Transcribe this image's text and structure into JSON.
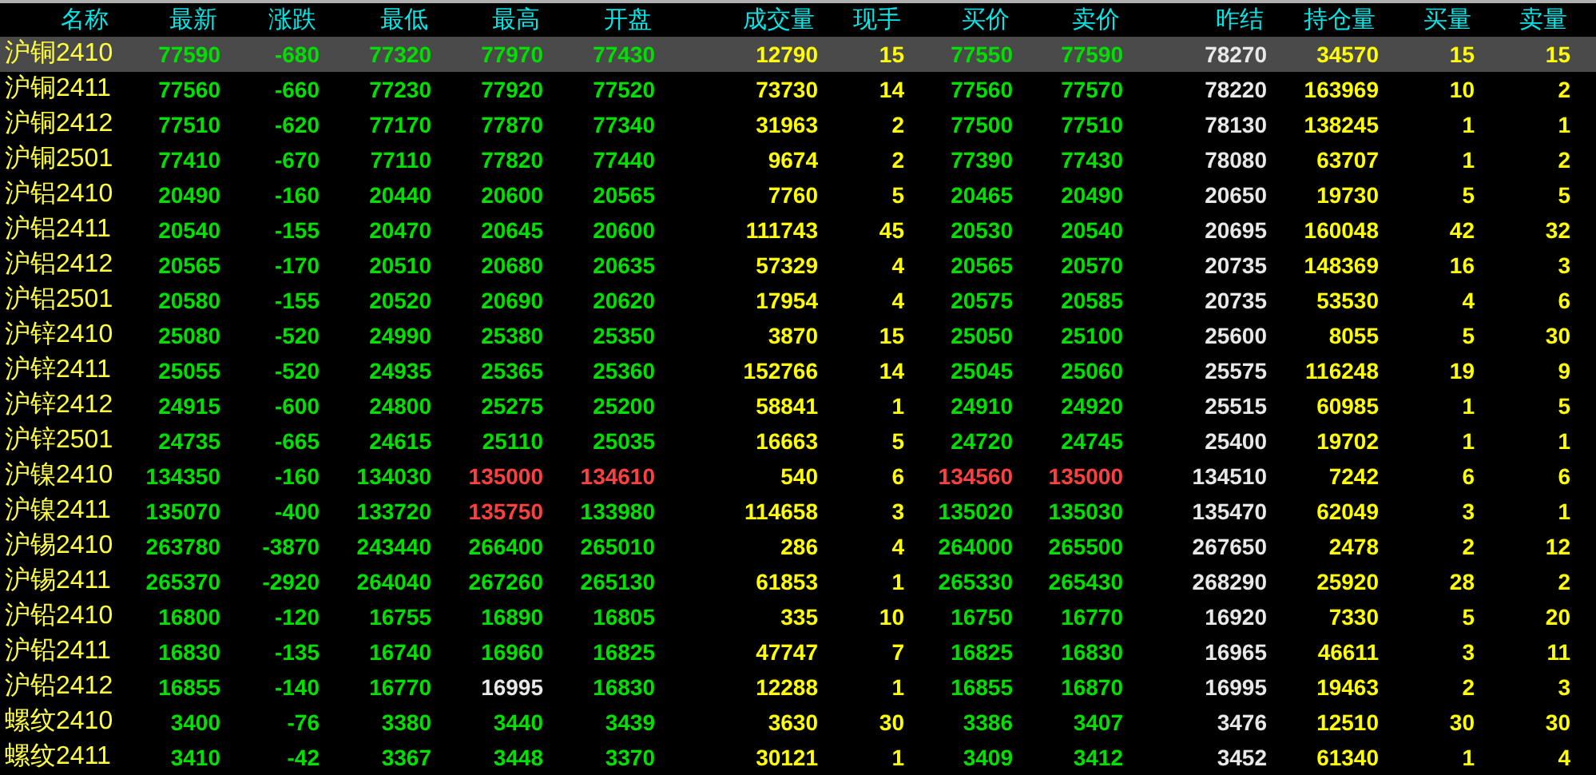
{
  "columns": [
    {
      "label": "名称",
      "kind": "name"
    },
    {
      "label": "最新",
      "kind": "price"
    },
    {
      "label": "涨跌",
      "kind": "price"
    },
    {
      "label": "最低",
      "kind": "price"
    },
    {
      "label": "最高",
      "kind": "price"
    },
    {
      "label": "开盘",
      "kind": "price"
    },
    {
      "label": "成交量",
      "kind": "volume"
    },
    {
      "label": "现手",
      "kind": "volume"
    },
    {
      "label": "买价",
      "kind": "price"
    },
    {
      "label": "卖价",
      "kind": "price"
    },
    {
      "label": "昨结",
      "kind": "settle"
    },
    {
      "label": "持仓量",
      "kind": "volume"
    },
    {
      "label": "买量",
      "kind": "volume"
    },
    {
      "label": "卖量",
      "kind": "volume"
    }
  ],
  "rows": [
    {
      "selected": true,
      "cells": [
        {
          "text": "沪铜2410"
        },
        {
          "text": "77590",
          "color": "#00e000"
        },
        {
          "text": "-680",
          "color": "#00e000"
        },
        {
          "text": "77320",
          "color": "#00e000"
        },
        {
          "text": "77970",
          "color": "#00e000"
        },
        {
          "text": "77430",
          "color": "#00e000"
        },
        {
          "text": "12790"
        },
        {
          "text": "15"
        },
        {
          "text": "77550",
          "color": "#00e000"
        },
        {
          "text": "77590",
          "color": "#00e000"
        },
        {
          "text": "78270"
        },
        {
          "text": "34570"
        },
        {
          "text": "15"
        },
        {
          "text": "15"
        }
      ]
    },
    {
      "selected": false,
      "cells": [
        {
          "text": "沪铜2411"
        },
        {
          "text": "77560",
          "color": "#00e000"
        },
        {
          "text": "-660",
          "color": "#00e000"
        },
        {
          "text": "77230",
          "color": "#00e000"
        },
        {
          "text": "77920",
          "color": "#00e000"
        },
        {
          "text": "77520",
          "color": "#00e000"
        },
        {
          "text": "73730"
        },
        {
          "text": "14"
        },
        {
          "text": "77560",
          "color": "#00e000"
        },
        {
          "text": "77570",
          "color": "#00e000"
        },
        {
          "text": "78220"
        },
        {
          "text": "163969"
        },
        {
          "text": "10"
        },
        {
          "text": "2"
        }
      ]
    },
    {
      "selected": false,
      "cells": [
        {
          "text": "沪铜2412"
        },
        {
          "text": "77510",
          "color": "#00e000"
        },
        {
          "text": "-620",
          "color": "#00e000"
        },
        {
          "text": "77170",
          "color": "#00e000"
        },
        {
          "text": "77870",
          "color": "#00e000"
        },
        {
          "text": "77340",
          "color": "#00e000"
        },
        {
          "text": "31963"
        },
        {
          "text": "2"
        },
        {
          "text": "77500",
          "color": "#00e000"
        },
        {
          "text": "77510",
          "color": "#00e000"
        },
        {
          "text": "78130"
        },
        {
          "text": "138245"
        },
        {
          "text": "1"
        },
        {
          "text": "1"
        }
      ]
    },
    {
      "selected": false,
      "cells": [
        {
          "text": "沪铜2501"
        },
        {
          "text": "77410",
          "color": "#00e000"
        },
        {
          "text": "-670",
          "color": "#00e000"
        },
        {
          "text": "77110",
          "color": "#00e000"
        },
        {
          "text": "77820",
          "color": "#00e000"
        },
        {
          "text": "77440",
          "color": "#00e000"
        },
        {
          "text": "9674"
        },
        {
          "text": "2"
        },
        {
          "text": "77390",
          "color": "#00e000"
        },
        {
          "text": "77430",
          "color": "#00e000"
        },
        {
          "text": "78080"
        },
        {
          "text": "63707"
        },
        {
          "text": "1"
        },
        {
          "text": "2"
        }
      ]
    },
    {
      "selected": false,
      "cells": [
        {
          "text": "沪铝2410"
        },
        {
          "text": "20490",
          "color": "#00e000"
        },
        {
          "text": "-160",
          "color": "#00e000"
        },
        {
          "text": "20440",
          "color": "#00e000"
        },
        {
          "text": "20600",
          "color": "#00e000"
        },
        {
          "text": "20565",
          "color": "#00e000"
        },
        {
          "text": "7760"
        },
        {
          "text": "5"
        },
        {
          "text": "20465",
          "color": "#00e000"
        },
        {
          "text": "20490",
          "color": "#00e000"
        },
        {
          "text": "20650"
        },
        {
          "text": "19730"
        },
        {
          "text": "5"
        },
        {
          "text": "5"
        }
      ]
    },
    {
      "selected": false,
      "cells": [
        {
          "text": "沪铝2411"
        },
        {
          "text": "20540",
          "color": "#00e000"
        },
        {
          "text": "-155",
          "color": "#00e000"
        },
        {
          "text": "20470",
          "color": "#00e000"
        },
        {
          "text": "20645",
          "color": "#00e000"
        },
        {
          "text": "20600",
          "color": "#00e000"
        },
        {
          "text": "111743"
        },
        {
          "text": "45"
        },
        {
          "text": "20530",
          "color": "#00e000"
        },
        {
          "text": "20540",
          "color": "#00e000"
        },
        {
          "text": "20695"
        },
        {
          "text": "160048"
        },
        {
          "text": "42"
        },
        {
          "text": "32"
        }
      ]
    },
    {
      "selected": false,
      "cells": [
        {
          "text": "沪铝2412"
        },
        {
          "text": "20565",
          "color": "#00e000"
        },
        {
          "text": "-170",
          "color": "#00e000"
        },
        {
          "text": "20510",
          "color": "#00e000"
        },
        {
          "text": "20680",
          "color": "#00e000"
        },
        {
          "text": "20635",
          "color": "#00e000"
        },
        {
          "text": "57329"
        },
        {
          "text": "4"
        },
        {
          "text": "20565",
          "color": "#00e000"
        },
        {
          "text": "20570",
          "color": "#00e000"
        },
        {
          "text": "20735"
        },
        {
          "text": "148369"
        },
        {
          "text": "16"
        },
        {
          "text": "3"
        }
      ]
    },
    {
      "selected": false,
      "cells": [
        {
          "text": "沪铝2501"
        },
        {
          "text": "20580",
          "color": "#00e000"
        },
        {
          "text": "-155",
          "color": "#00e000"
        },
        {
          "text": "20520",
          "color": "#00e000"
        },
        {
          "text": "20690",
          "color": "#00e000"
        },
        {
          "text": "20620",
          "color": "#00e000"
        },
        {
          "text": "17954"
        },
        {
          "text": "4"
        },
        {
          "text": "20575",
          "color": "#00e000"
        },
        {
          "text": "20585",
          "color": "#00e000"
        },
        {
          "text": "20735"
        },
        {
          "text": "53530"
        },
        {
          "text": "4"
        },
        {
          "text": "6"
        }
      ]
    },
    {
      "selected": false,
      "cells": [
        {
          "text": "沪锌2410"
        },
        {
          "text": "25080",
          "color": "#00e000"
        },
        {
          "text": "-520",
          "color": "#00e000"
        },
        {
          "text": "24990",
          "color": "#00e000"
        },
        {
          "text": "25380",
          "color": "#00e000"
        },
        {
          "text": "25350",
          "color": "#00e000"
        },
        {
          "text": "3870"
        },
        {
          "text": "15"
        },
        {
          "text": "25050",
          "color": "#00e000"
        },
        {
          "text": "25100",
          "color": "#00e000"
        },
        {
          "text": "25600"
        },
        {
          "text": "8055"
        },
        {
          "text": "5"
        },
        {
          "text": "30"
        }
      ]
    },
    {
      "selected": false,
      "cells": [
        {
          "text": "沪锌2411"
        },
        {
          "text": "25055",
          "color": "#00e000"
        },
        {
          "text": "-520",
          "color": "#00e000"
        },
        {
          "text": "24935",
          "color": "#00e000"
        },
        {
          "text": "25365",
          "color": "#00e000"
        },
        {
          "text": "25360",
          "color": "#00e000"
        },
        {
          "text": "152766"
        },
        {
          "text": "14"
        },
        {
          "text": "25045",
          "color": "#00e000"
        },
        {
          "text": "25060",
          "color": "#00e000"
        },
        {
          "text": "25575"
        },
        {
          "text": "116248"
        },
        {
          "text": "19"
        },
        {
          "text": "9"
        }
      ]
    },
    {
      "selected": false,
      "cells": [
        {
          "text": "沪锌2412"
        },
        {
          "text": "24915",
          "color": "#00e000"
        },
        {
          "text": "-600",
          "color": "#00e000"
        },
        {
          "text": "24800",
          "color": "#00e000"
        },
        {
          "text": "25275",
          "color": "#00e000"
        },
        {
          "text": "25200",
          "color": "#00e000"
        },
        {
          "text": "58841"
        },
        {
          "text": "1"
        },
        {
          "text": "24910",
          "color": "#00e000"
        },
        {
          "text": "24920",
          "color": "#00e000"
        },
        {
          "text": "25515"
        },
        {
          "text": "60985"
        },
        {
          "text": "1"
        },
        {
          "text": "5"
        }
      ]
    },
    {
      "selected": false,
      "cells": [
        {
          "text": "沪锌2501"
        },
        {
          "text": "24735",
          "color": "#00e000"
        },
        {
          "text": "-665",
          "color": "#00e000"
        },
        {
          "text": "24615",
          "color": "#00e000"
        },
        {
          "text": "25110",
          "color": "#00e000"
        },
        {
          "text": "25035",
          "color": "#00e000"
        },
        {
          "text": "16663"
        },
        {
          "text": "5"
        },
        {
          "text": "24720",
          "color": "#00e000"
        },
        {
          "text": "24745",
          "color": "#00e000"
        },
        {
          "text": "25400"
        },
        {
          "text": "19702"
        },
        {
          "text": "1"
        },
        {
          "text": "1"
        }
      ]
    },
    {
      "selected": false,
      "cells": [
        {
          "text": "沪镍2410"
        },
        {
          "text": "134350",
          "color": "#00e000"
        },
        {
          "text": "-160",
          "color": "#00e000"
        },
        {
          "text": "134030",
          "color": "#00e000"
        },
        {
          "text": "135000",
          "color": "#ff4040"
        },
        {
          "text": "134610",
          "color": "#ff4040"
        },
        {
          "text": "540"
        },
        {
          "text": "6"
        },
        {
          "text": "134560",
          "color": "#ff4040"
        },
        {
          "text": "135000",
          "color": "#ff4040"
        },
        {
          "text": "134510"
        },
        {
          "text": "7242"
        },
        {
          "text": "6"
        },
        {
          "text": "6"
        }
      ]
    },
    {
      "selected": false,
      "cells": [
        {
          "text": "沪镍2411"
        },
        {
          "text": "135070",
          "color": "#00e000"
        },
        {
          "text": "-400",
          "color": "#00e000"
        },
        {
          "text": "133720",
          "color": "#00e000"
        },
        {
          "text": "135750",
          "color": "#ff4040"
        },
        {
          "text": "133980",
          "color": "#00e000"
        },
        {
          "text": "114658"
        },
        {
          "text": "3"
        },
        {
          "text": "135020",
          "color": "#00e000"
        },
        {
          "text": "135030",
          "color": "#00e000"
        },
        {
          "text": "135470"
        },
        {
          "text": "62049"
        },
        {
          "text": "3"
        },
        {
          "text": "1"
        }
      ]
    },
    {
      "selected": false,
      "cells": [
        {
          "text": "沪锡2410"
        },
        {
          "text": "263780",
          "color": "#00e000"
        },
        {
          "text": "-3870",
          "color": "#00e000"
        },
        {
          "text": "243440",
          "color": "#00e000"
        },
        {
          "text": "266400",
          "color": "#00e000"
        },
        {
          "text": "265010",
          "color": "#00e000"
        },
        {
          "text": "286"
        },
        {
          "text": "4"
        },
        {
          "text": "264000",
          "color": "#00e000"
        },
        {
          "text": "265500",
          "color": "#00e000"
        },
        {
          "text": "267650"
        },
        {
          "text": "2478"
        },
        {
          "text": "2"
        },
        {
          "text": "12"
        }
      ]
    },
    {
      "selected": false,
      "cells": [
        {
          "text": "沪锡2411"
        },
        {
          "text": "265370",
          "color": "#00e000"
        },
        {
          "text": "-2920",
          "color": "#00e000"
        },
        {
          "text": "264040",
          "color": "#00e000"
        },
        {
          "text": "267260",
          "color": "#00e000"
        },
        {
          "text": "265130",
          "color": "#00e000"
        },
        {
          "text": "61853"
        },
        {
          "text": "1"
        },
        {
          "text": "265330",
          "color": "#00e000"
        },
        {
          "text": "265430",
          "color": "#00e000"
        },
        {
          "text": "268290"
        },
        {
          "text": "25920"
        },
        {
          "text": "28"
        },
        {
          "text": "2"
        }
      ]
    },
    {
      "selected": false,
      "cells": [
        {
          "text": "沪铅2410"
        },
        {
          "text": "16800",
          "color": "#00e000"
        },
        {
          "text": "-120",
          "color": "#00e000"
        },
        {
          "text": "16755",
          "color": "#00e000"
        },
        {
          "text": "16890",
          "color": "#00e000"
        },
        {
          "text": "16805",
          "color": "#00e000"
        },
        {
          "text": "335"
        },
        {
          "text": "10"
        },
        {
          "text": "16750",
          "color": "#00e000"
        },
        {
          "text": "16770",
          "color": "#00e000"
        },
        {
          "text": "16920"
        },
        {
          "text": "7330"
        },
        {
          "text": "5"
        },
        {
          "text": "20"
        }
      ]
    },
    {
      "selected": false,
      "cells": [
        {
          "text": "沪铅2411"
        },
        {
          "text": "16830",
          "color": "#00e000"
        },
        {
          "text": "-135",
          "color": "#00e000"
        },
        {
          "text": "16740",
          "color": "#00e000"
        },
        {
          "text": "16960",
          "color": "#00e000"
        },
        {
          "text": "16825",
          "color": "#00e000"
        },
        {
          "text": "47747"
        },
        {
          "text": "7"
        },
        {
          "text": "16825",
          "color": "#00e000"
        },
        {
          "text": "16830",
          "color": "#00e000"
        },
        {
          "text": "16965"
        },
        {
          "text": "46611"
        },
        {
          "text": "3"
        },
        {
          "text": "11"
        }
      ]
    },
    {
      "selected": false,
      "cells": [
        {
          "text": "沪铅2412"
        },
        {
          "text": "16855",
          "color": "#00e000"
        },
        {
          "text": "-140",
          "color": "#00e000"
        },
        {
          "text": "16770",
          "color": "#00e000"
        },
        {
          "text": "16995",
          "color": "#e8e8e8"
        },
        {
          "text": "16830",
          "color": "#00e000"
        },
        {
          "text": "12288"
        },
        {
          "text": "1"
        },
        {
          "text": "16855",
          "color": "#00e000"
        },
        {
          "text": "16870",
          "color": "#00e000"
        },
        {
          "text": "16995"
        },
        {
          "text": "19463"
        },
        {
          "text": "2"
        },
        {
          "text": "3"
        }
      ]
    },
    {
      "selected": false,
      "cells": [
        {
          "text": "螺纹2410"
        },
        {
          "text": "3400",
          "color": "#00e000"
        },
        {
          "text": "-76",
          "color": "#00e000"
        },
        {
          "text": "3380",
          "color": "#00e000"
        },
        {
          "text": "3440",
          "color": "#00e000"
        },
        {
          "text": "3439",
          "color": "#00e000"
        },
        {
          "text": "3630"
        },
        {
          "text": "30"
        },
        {
          "text": "3386",
          "color": "#00e000"
        },
        {
          "text": "3407",
          "color": "#00e000"
        },
        {
          "text": "3476"
        },
        {
          "text": "12510"
        },
        {
          "text": "30"
        },
        {
          "text": "30"
        }
      ]
    },
    {
      "selected": false,
      "cells": [
        {
          "text": "螺纹2411"
        },
        {
          "text": "3410",
          "color": "#00e000"
        },
        {
          "text": "-42",
          "color": "#00e000"
        },
        {
          "text": "3367",
          "color": "#00e000"
        },
        {
          "text": "3448",
          "color": "#00e000"
        },
        {
          "text": "3370",
          "color": "#00e000"
        },
        {
          "text": "30121"
        },
        {
          "text": "1"
        },
        {
          "text": "3409",
          "color": "#00e000"
        },
        {
          "text": "3412",
          "color": "#00e000"
        },
        {
          "text": "3452"
        },
        {
          "text": "61340"
        },
        {
          "text": "1"
        },
        {
          "text": "4"
        }
      ]
    }
  ]
}
